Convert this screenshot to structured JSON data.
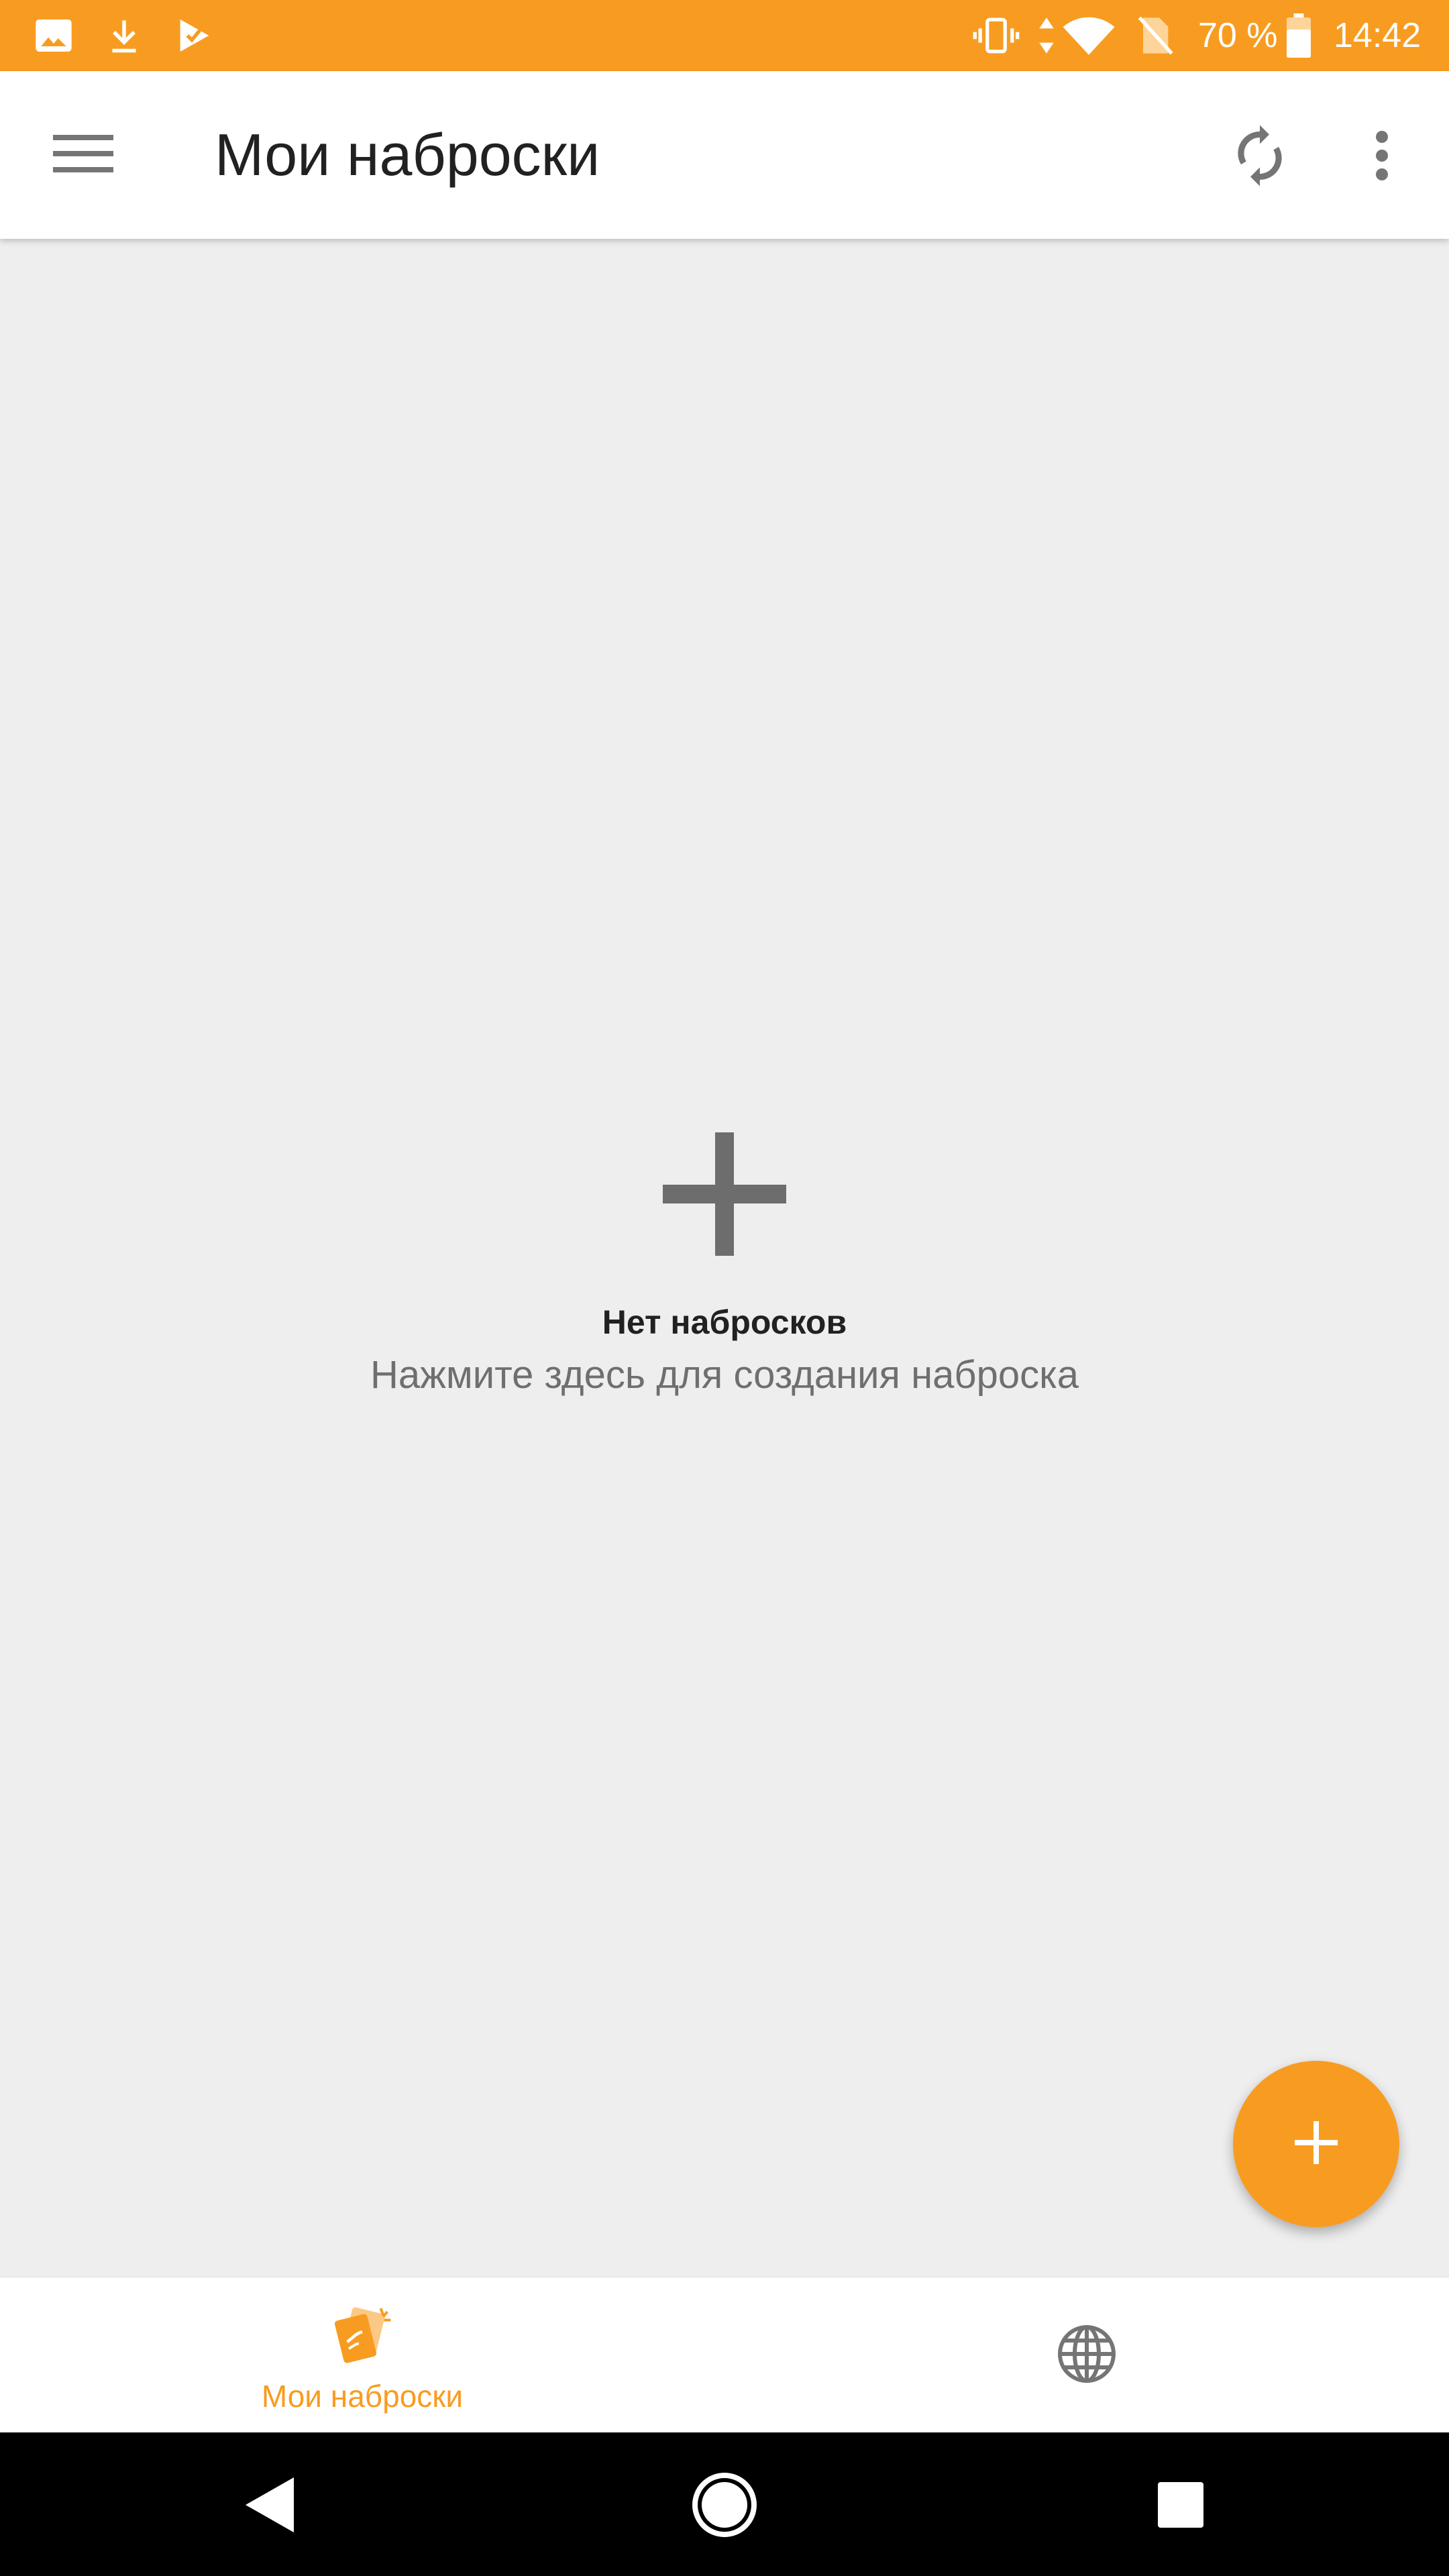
{
  "status_bar": {
    "battery": "70 %",
    "time": "14:42",
    "left_icons": [
      "image-icon",
      "download-icon",
      "play-store-icon"
    ],
    "right_icons": [
      "vibrate-icon",
      "data-arrows-icon",
      "wifi-icon",
      "no-sim-icon",
      "battery-icon"
    ]
  },
  "app_bar": {
    "title": "Мои наброски",
    "icons": [
      "menu-icon",
      "sync-icon",
      "more-vert-icon"
    ]
  },
  "empty_state": {
    "title": "Нет набросков",
    "subtitle": "Нажмите здесь для создания наброска",
    "icon": "plus-icon"
  },
  "fab": {
    "icon": "add-icon"
  },
  "bottom_nav": {
    "tabs": [
      {
        "label": "Мои наброски",
        "icon": "sketches-icon",
        "selected": true
      },
      {
        "label": "",
        "icon": "globe-icon",
        "selected": false
      }
    ]
  },
  "system_nav": {
    "icons": [
      "back-icon",
      "home-icon",
      "recents-icon"
    ]
  },
  "colors": {
    "accent": "#f89c21",
    "background": "#eeeeee",
    "icon_gray": "#757575",
    "title_text": "#212121",
    "subtitle_text": "#6f6f6f"
  }
}
